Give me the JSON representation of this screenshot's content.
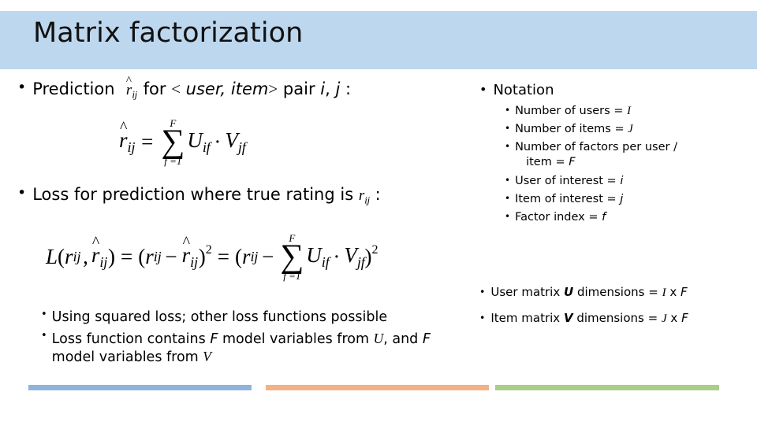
{
  "slide": {
    "title": "Matrix factorization",
    "background_color": "#ffffff",
    "title_band_color": "#bdd7ee"
  },
  "left": {
    "prediction_bullet": {
      "lead": "Prediction",
      "rhat_base": "r",
      "rhat_hat": "^",
      "rhat_sub": "ij",
      "mid": "for",
      "angle_open": "<",
      "user_word": "user,",
      "item_word": "item",
      "angle_close": ">",
      "pair_word": "pair",
      "i_var": "i",
      "comma": ",",
      "j_var": "j",
      "colon": ":"
    },
    "prediction_formula": {
      "lhs_base": "r",
      "lhs_hat": "^",
      "lhs_sub": "ij",
      "equals": "=",
      "sum_upper": "F",
      "sum_symbol": "∑",
      "sum_lower": "f =1",
      "u_base": "U",
      "u_sub": "if",
      "dot": "·",
      "v_base": "V",
      "v_sub": "jf"
    },
    "loss_bullet": {
      "lead": "Loss for prediction where true rating is",
      "r_base": "r",
      "r_sub": "ij",
      "colon": ":"
    },
    "loss_formula": {
      "L": "L",
      "open_paren": "(",
      "r_base": "r",
      "r_sub": "ij",
      "comma": ",",
      "rhat_base": "r",
      "rhat_hat": "^",
      "rhat_sub": "ij",
      "close_paren": ")",
      "equals": "=",
      "minus": "−",
      "square": "2",
      "sum_upper": "F",
      "sum_symbol": "∑",
      "sum_lower": "f =1",
      "u_base": "U",
      "u_sub": "if",
      "dot": "·",
      "v_base": "V",
      "v_sub": "jf"
    },
    "bottom_bullets": [
      {
        "id": "squared-loss",
        "parts": [
          {
            "text": "Using squared loss; other loss functions possible",
            "style": "normal"
          }
        ]
      },
      {
        "id": "loss-function-vars",
        "parts": [
          {
            "text": "Loss function contains ",
            "style": "normal"
          },
          {
            "text": "F",
            "style": "slanted"
          },
          {
            "text": " model variables from ",
            "style": "normal"
          },
          {
            "text": "U",
            "style": "math"
          },
          {
            "text": ",",
            "style": "normal"
          },
          {
            "text": " and ",
            "style": "normal"
          },
          {
            "text": "F",
            "style": "slanted"
          },
          {
            "text": " model variables from ",
            "style": "normal"
          },
          {
            "text": "V",
            "style": "math"
          }
        ],
        "line1": "Loss function contains F model variables from U,",
        "line2": "and F model variables from V"
      }
    ]
  },
  "right": {
    "notation_heading": "Notation",
    "notation_items": [
      {
        "label": "Number of users = ",
        "symbol": "I",
        "cont": ""
      },
      {
        "label": "Number of items = ",
        "symbol": "J",
        "cont": ""
      },
      {
        "label": "Number of factors per user / ",
        "symbol": "",
        "cont": "item = ",
        "cont_symbol": "F"
      },
      {
        "label": "User of interest = ",
        "symbol": "i",
        "cont": ""
      },
      {
        "label": "Item of interest = ",
        "symbol": "j",
        "cont": ""
      },
      {
        "label": "Factor index = ",
        "symbol": "f",
        "cont": ""
      }
    ],
    "matrix_items": [
      {
        "prefix": "User matrix ",
        "matrix_symbol": "U",
        "middle": " dimensions = ",
        "dim_rows": "I",
        "times": "x",
        "dim_cols": "F"
      },
      {
        "prefix": "Item matrix ",
        "matrix_symbol": "V",
        "middle": " dimensions = ",
        "dim_rows": "J",
        "times": "x",
        "dim_cols": "F"
      }
    ]
  },
  "decoration": {
    "bullet_glyph": "•",
    "bars": [
      {
        "name": "blue",
        "color": "#8fb4dc"
      },
      {
        "name": "orange",
        "color": "#f3b283"
      },
      {
        "name": "green",
        "color": "#a9cf85"
      }
    ]
  }
}
